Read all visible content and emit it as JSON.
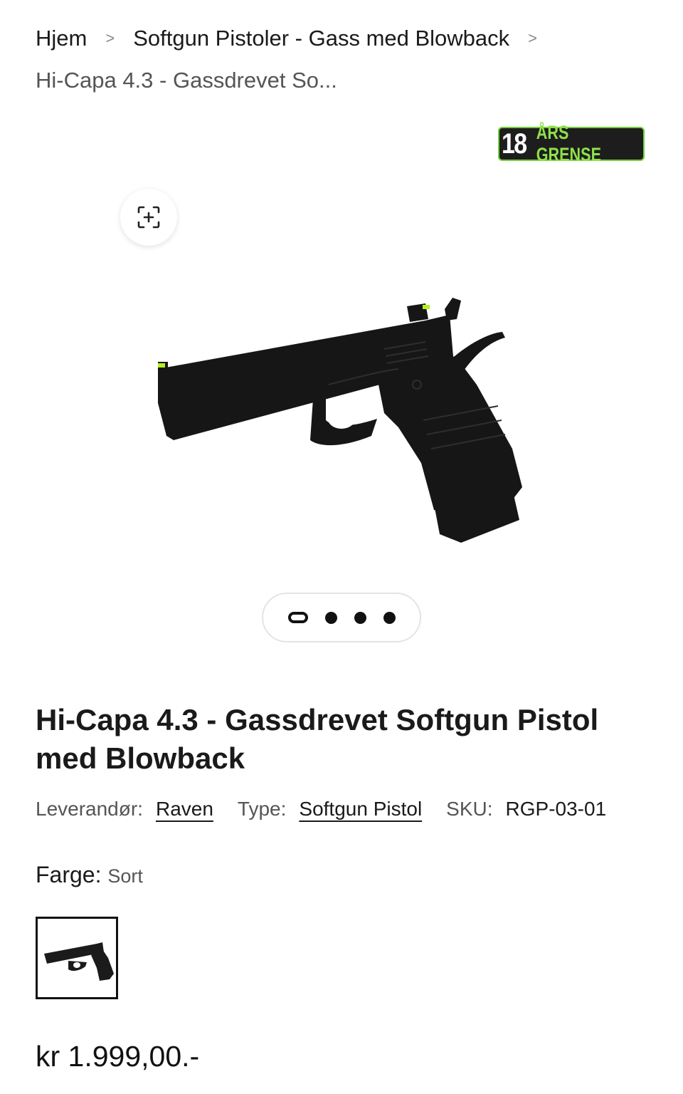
{
  "breadcrumb": {
    "home": "Hjem",
    "category": "Softgun Pistoler - Gass med Blowback",
    "separator": ">",
    "current": "Hi-Capa 4.3 - Gassdrevet So..."
  },
  "badge": {
    "number": "18",
    "text": "ÅRS GRENSE"
  },
  "gallery": {
    "slide_count": 4,
    "active_index": 0
  },
  "product": {
    "title": "Hi-Capa 4.3 - Gassdrevet Softgun Pistol med Blowback",
    "vendor_label": "Leverandør:",
    "vendor": "Raven",
    "type_label": "Type:",
    "type": "Softgun Pistol",
    "sku_label": "SKU:",
    "sku": "RGP-03-01",
    "color_label": "Farge:",
    "color": "Sort",
    "price": "kr 1.999,00.-"
  },
  "colors": {
    "sight_accent": "#b6f01e",
    "badge_border": "#6fcf3a",
    "badge_text": "#8fe04a"
  }
}
